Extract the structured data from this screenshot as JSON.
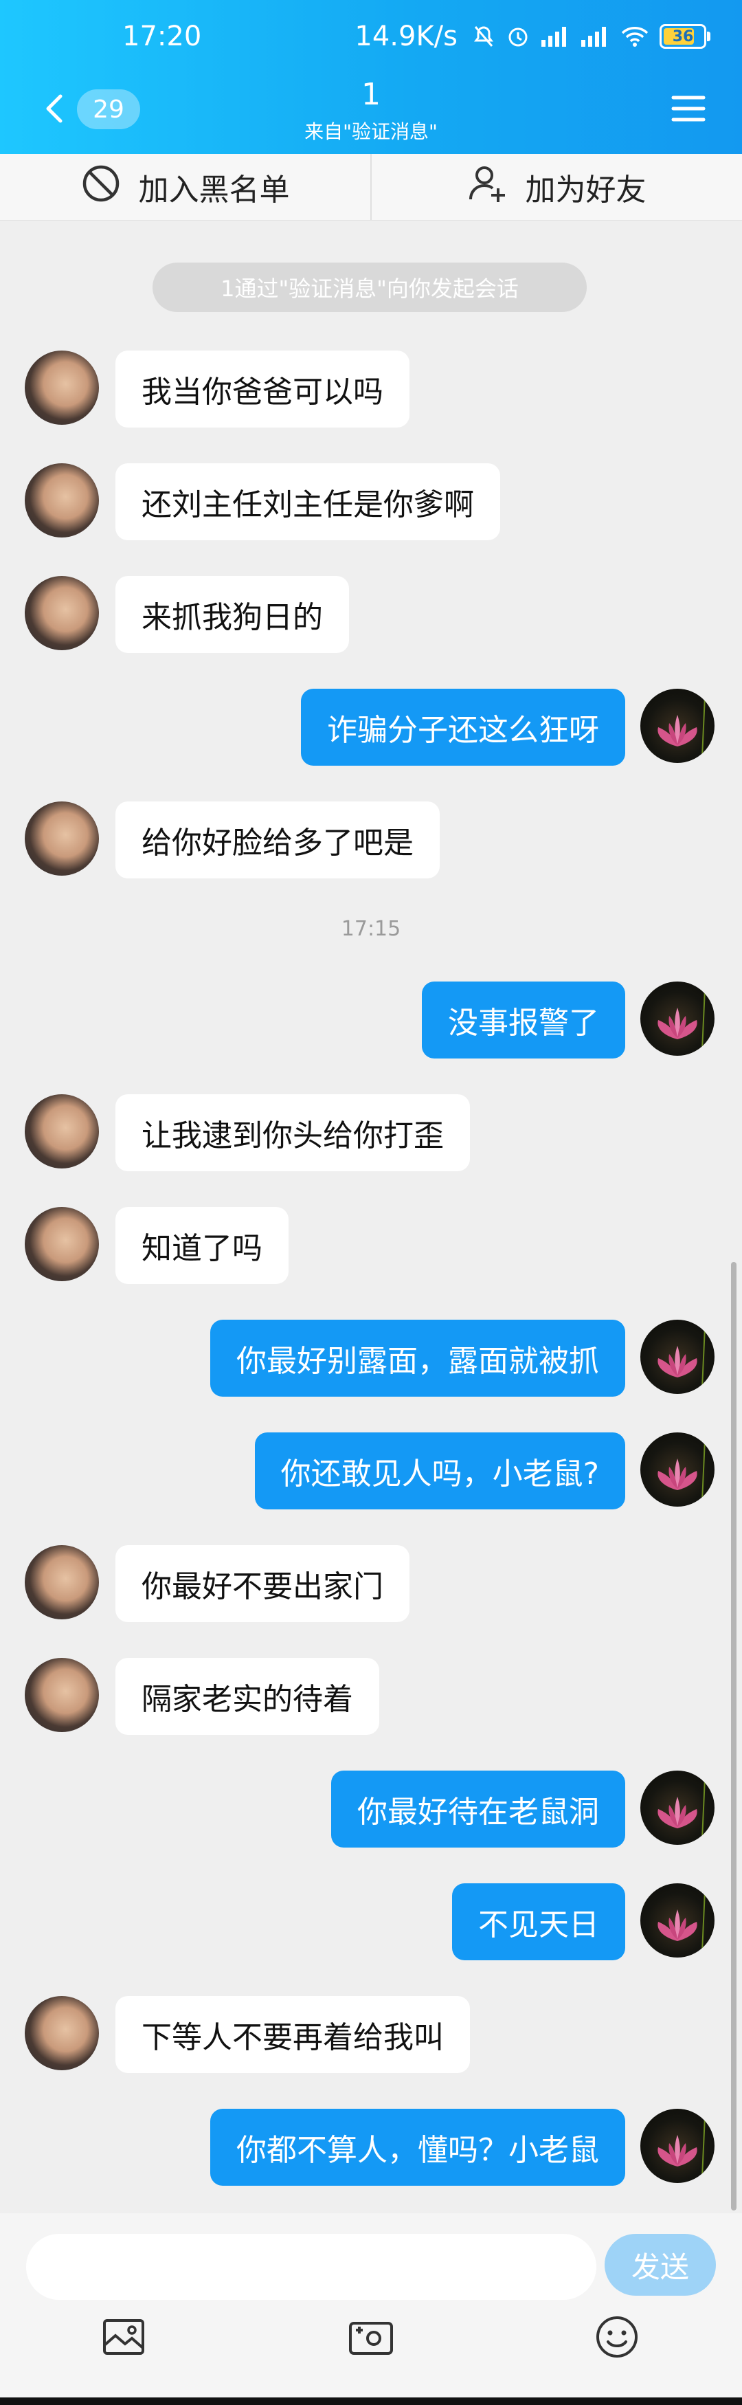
{
  "status": {
    "time": "17:20",
    "net_speed": "14.9K/s",
    "battery": "36"
  },
  "header": {
    "unread": "29",
    "title": "1",
    "subtitle": "来自\"验证消息\""
  },
  "actions": {
    "blacklist": "加入黑名单",
    "add_friend": "加为好友"
  },
  "chat": {
    "system_notice": "1通过\"验证消息\"向你发起会话",
    "time_separator": "17:15",
    "messages": [
      {
        "side": "left",
        "text": "我当你爸爸可以吗"
      },
      {
        "side": "left",
        "text": "还刘主任刘主任是你爹啊"
      },
      {
        "side": "left",
        "text": "来抓我狗日的"
      },
      {
        "side": "right",
        "text": "诈骗分子还这么狂呀"
      },
      {
        "side": "left",
        "text": "给你好脸给多了吧是"
      },
      {
        "side": "right",
        "text": "没事报警了"
      },
      {
        "side": "left",
        "text": "让我逮到你头给你打歪"
      },
      {
        "side": "left",
        "text": "知道了吗"
      },
      {
        "side": "right",
        "text": "你最好别露面，露面就被抓"
      },
      {
        "side": "right",
        "text": "你还敢见人吗，小老鼠?"
      },
      {
        "side": "left",
        "text": "你最好不要出家门"
      },
      {
        "side": "left",
        "text": "隔家老实的待着"
      },
      {
        "side": "right",
        "text": "你最好待在老鼠洞"
      },
      {
        "side": "right",
        "text": "不见天日"
      },
      {
        "side": "left",
        "text": "下等人不要再着给我叫"
      },
      {
        "side": "right",
        "text": "你都不算人，懂吗？小老鼠"
      }
    ]
  },
  "composer": {
    "placeholder": "",
    "send_label": "发送"
  },
  "colors": {
    "accent": "#1499f5",
    "header_start": "#1ec7ff",
    "header_end": "#1399f0"
  },
  "icons": [
    "back-chevron-icon",
    "menu-icon",
    "block-icon",
    "add-user-icon",
    "image-icon",
    "camera-icon",
    "emoji-icon"
  ]
}
